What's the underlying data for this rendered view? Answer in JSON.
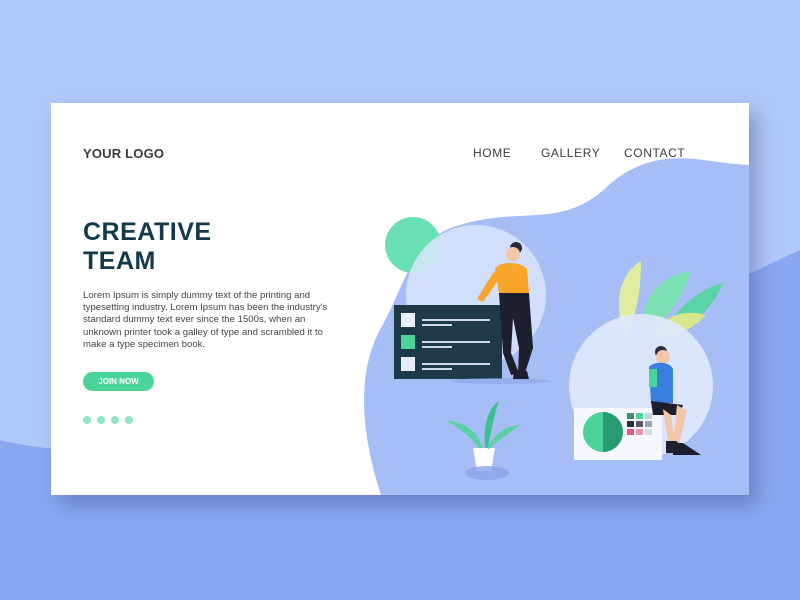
{
  "header": {
    "logo": "YOUR LOGO",
    "nav": [
      "HOME",
      "GALLERY",
      "CONTACT"
    ]
  },
  "hero": {
    "title_line1": "CREATIVE",
    "title_line2": "TEAM",
    "description": "Lorem Ipsum is simply dummy text of the printing and typesetting industry. Lorem Ipsum has been the industry's standard dummy text ever since the 1500s, when an unknown printer took a galley of type and scrambled it to make a type specimen book.",
    "cta_label": "JOIN NOW"
  },
  "carousel": {
    "dot_count": 4,
    "active_index": 0
  },
  "colors": {
    "page_bg": "#b1c9f8",
    "accent_green": "#4ad497",
    "headline": "#123a4a",
    "blob": "#a7bdf6",
    "dark_panel": "#1e3a48"
  }
}
